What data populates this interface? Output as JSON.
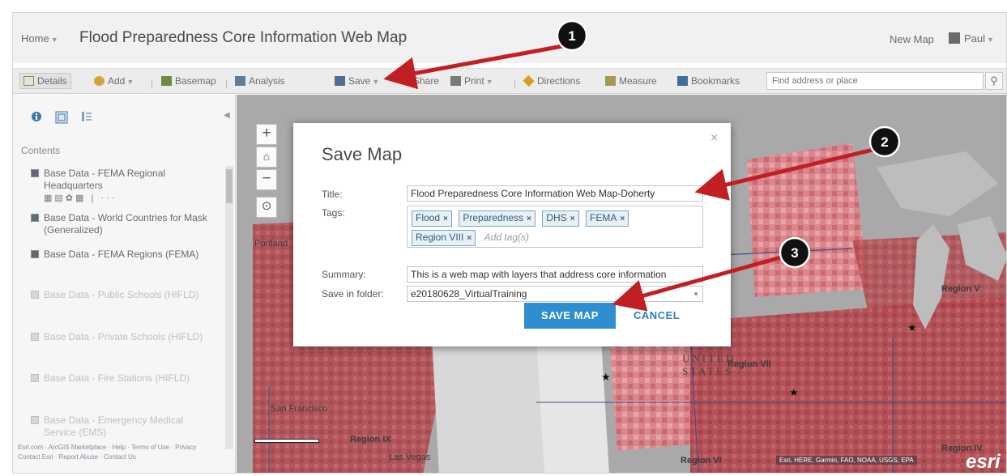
{
  "header": {
    "home_label": "Home",
    "map_title": "Flood Preparedness Core Information Web Map",
    "new_map_label": "New Map",
    "user_name": "Paul"
  },
  "toolbar": {
    "details": "Details",
    "add": "Add",
    "basemap": "Basemap",
    "analysis": "Analysis",
    "save": "Save",
    "share": "Share",
    "print": "Print",
    "directions": "Directions",
    "measure": "Measure",
    "bookmarks": "Bookmarks",
    "search_placeholder": "Find address or place"
  },
  "panel": {
    "contents_label": "Contents",
    "layers": [
      {
        "name": "Base Data - FEMA Regional Headquarters",
        "checked": true
      },
      {
        "name": "Base Data - World Countries for Mask (Generalized)",
        "checked": true
      },
      {
        "name": "Base Data - FEMA Regions (FEMA)",
        "checked": true
      },
      {
        "name": "Base Data - Public Schools (HIFLD)",
        "checked": false
      },
      {
        "name": "Base Data - Private Schools (HIFLD)",
        "checked": false
      },
      {
        "name": "Base Data - Fire Stations (HIFLD)",
        "checked": false
      },
      {
        "name": "Base Data - Emergency Medical Service (EMS)",
        "checked": false
      }
    ],
    "footer_line1": "Esri.com · ArcGIS Marketplace · Help · Terms of Use · Privacy",
    "footer_line2": "Contact Esri · Report Abuse · Contact Us"
  },
  "map": {
    "labels": {
      "region_vii": "Region VII",
      "region_ix": "Region IX",
      "region_vi": "Region VI",
      "region_iv": "Region IV",
      "region_v": "Region V",
      "united_states": "UNITED STATES",
      "las_vegas": "Las Vegas",
      "san_francisco": "San Francisco",
      "portland": "Portland"
    },
    "attribution": "Esri, HERE, Garmin, FAO, NOAA, USGS, EPA",
    "logo": "esri",
    "colors": {
      "map_base": "#a9a9a9",
      "flood_fill": "#b4474f",
      "flood_light": "#d9868c",
      "land_light": "#d8d8d8",
      "water": "#bebebe"
    }
  },
  "modal": {
    "title": "Save Map",
    "close_glyph": "×",
    "title_label": "Title:",
    "title_value": "Flood Preparedness Core Information Web Map-Doherty",
    "tags_label": "Tags:",
    "tags": [
      "Flood",
      "Preparedness",
      "DHS",
      "FEMA",
      "Region VIII"
    ],
    "tag_placeholder": "Add tag(s)",
    "summary_label": "Summary:",
    "summary_value": "This is a web map with layers that address core information",
    "folder_label": "Save in folder:",
    "folder_value": "e20180628_VirtualTraining",
    "save_button": "SAVE MAP",
    "cancel_button": "CANCEL"
  },
  "annotations": {
    "callout_1": "1",
    "callout_2": "2",
    "callout_3": "3",
    "arrow_color": "#c21f24"
  }
}
